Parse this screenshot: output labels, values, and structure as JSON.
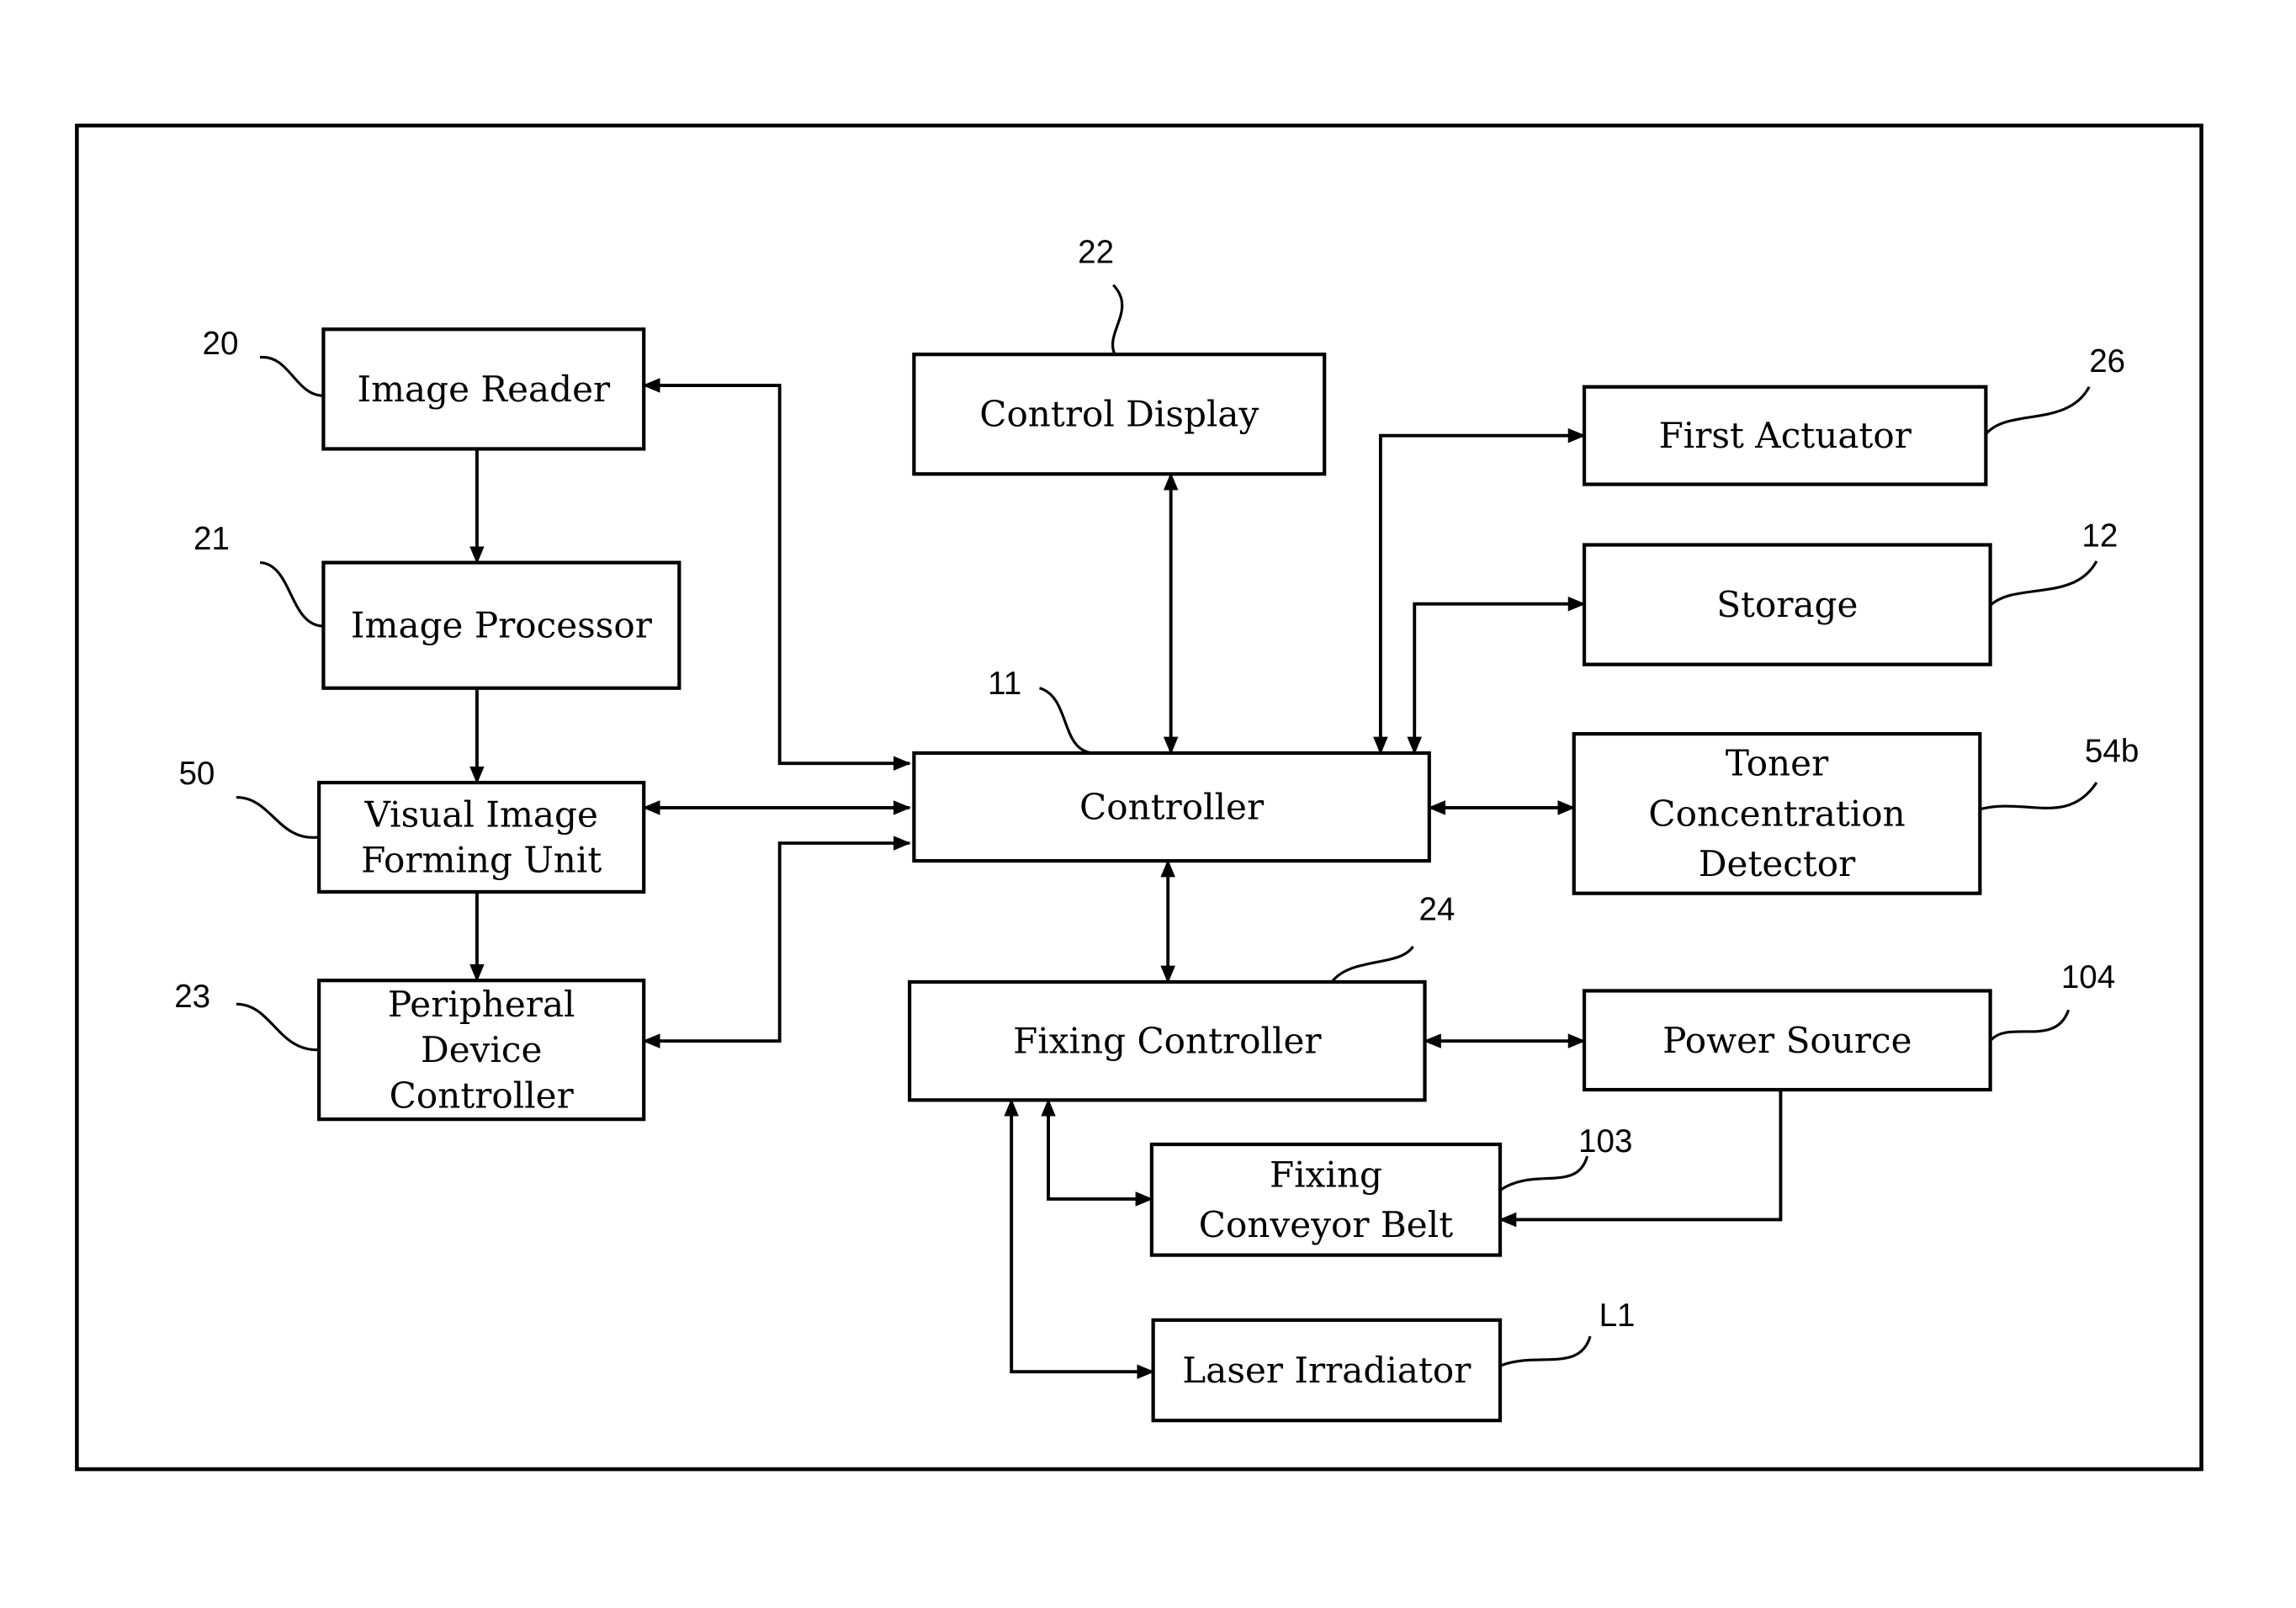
{
  "figure": {
    "blocks": [
      {
        "id": "image-reader",
        "ref": "20",
        "lines": [
          "Image Reader"
        ]
      },
      {
        "id": "image-processor",
        "ref": "21",
        "lines": [
          "Image Processor"
        ]
      },
      {
        "id": "visual-image-forming-unit",
        "ref": "50",
        "lines": [
          "Visual Image",
          "Forming Unit"
        ]
      },
      {
        "id": "peripheral-device-controller",
        "ref": "23",
        "lines": [
          "Peripheral",
          "Device",
          "Controller"
        ]
      },
      {
        "id": "control-display",
        "ref": "22",
        "lines": [
          "Control Display"
        ]
      },
      {
        "id": "controller",
        "ref": "11",
        "lines": [
          "Controller"
        ]
      },
      {
        "id": "fixing-controller",
        "ref": "24",
        "lines": [
          "Fixing Controller"
        ]
      },
      {
        "id": "first-actuator",
        "ref": "26",
        "lines": [
          "First Actuator"
        ]
      },
      {
        "id": "storage",
        "ref": "12",
        "lines": [
          "Storage"
        ]
      },
      {
        "id": "toner-concentration-detector",
        "ref": "54b",
        "lines": [
          "Toner",
          "Concentration",
          "Detector"
        ]
      },
      {
        "id": "power-source",
        "ref": "104",
        "lines": [
          "Power Source"
        ]
      },
      {
        "id": "fixing-conveyor-belt",
        "ref": "103",
        "lines": [
          "Fixing",
          "Conveyor Belt"
        ]
      },
      {
        "id": "laser-irradiator",
        "ref": "L1",
        "lines": [
          "Laser Irradiator"
        ]
      }
    ],
    "connections": [
      {
        "from": "image-reader",
        "to": "image-processor",
        "direction": "one-way"
      },
      {
        "from": "image-processor",
        "to": "visual-image-forming-unit",
        "direction": "one-way"
      },
      {
        "from": "visual-image-forming-unit",
        "to": "peripheral-device-controller",
        "direction": "one-way"
      },
      {
        "from": "controller",
        "to": "image-reader",
        "direction": "two-way"
      },
      {
        "from": "controller",
        "to": "visual-image-forming-unit",
        "direction": "two-way"
      },
      {
        "from": "controller",
        "to": "peripheral-device-controller",
        "direction": "two-way"
      },
      {
        "from": "controller",
        "to": "control-display",
        "direction": "two-way"
      },
      {
        "from": "controller",
        "to": "first-actuator",
        "direction": "two-way"
      },
      {
        "from": "controller",
        "to": "storage",
        "direction": "two-way"
      },
      {
        "from": "controller",
        "to": "toner-concentration-detector",
        "direction": "two-way"
      },
      {
        "from": "controller",
        "to": "fixing-controller",
        "direction": "two-way"
      },
      {
        "from": "fixing-controller",
        "to": "power-source",
        "direction": "two-way"
      },
      {
        "from": "fixing-controller",
        "to": "fixing-conveyor-belt",
        "direction": "two-way"
      },
      {
        "from": "fixing-controller",
        "to": "laser-irradiator",
        "direction": "two-way"
      },
      {
        "from": "power-source",
        "to": "fixing-conveyor-belt",
        "direction": "one-way"
      }
    ]
  }
}
